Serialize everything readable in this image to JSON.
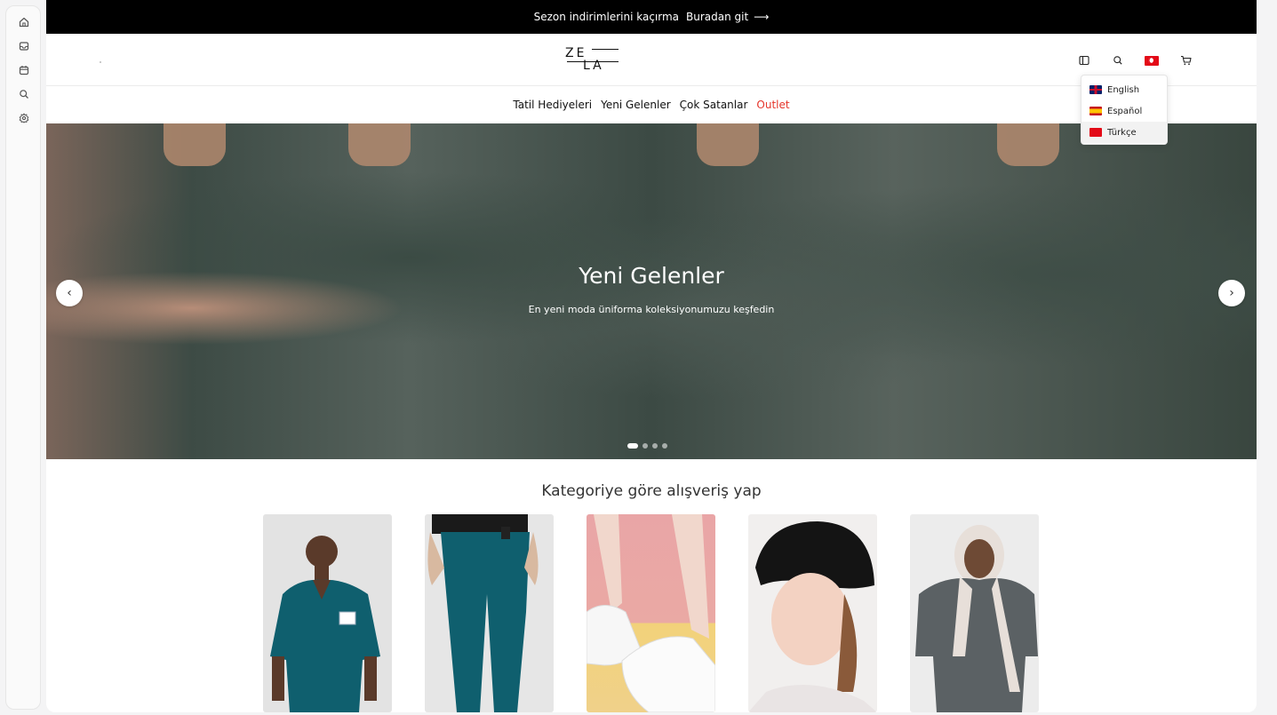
{
  "sidebar": {
    "items": [
      {
        "icon": "home-icon"
      },
      {
        "icon": "inbox-icon"
      },
      {
        "icon": "calendar-icon"
      },
      {
        "icon": "search-icon"
      },
      {
        "icon": "settings-icon"
      }
    ]
  },
  "announcement": {
    "text": "Sezon indirimlerini kaçırma",
    "link": "Buradan git",
    "arrow": "⟶"
  },
  "logo": {
    "top": "ZE",
    "bottom": "LA"
  },
  "header_icons": [
    "sidebar-toggle-icon",
    "search-icon",
    "turkish-flag-icon",
    "cart-icon"
  ],
  "language_menu": {
    "items": [
      {
        "label": "English",
        "flag": "uk-flag-icon"
      },
      {
        "label": "Español",
        "flag": "spain-flag-icon"
      },
      {
        "label": "Türkçe",
        "flag": "turkey-flag-icon",
        "selected": true
      }
    ]
  },
  "nav": {
    "items": [
      "Tatil Hediyeleri",
      "Yeni Gelenler",
      "Çok Satanlar",
      "Outlet"
    ],
    "outlet_color": "#e5352b"
  },
  "hero": {
    "title": "Yeni Gelenler",
    "subtitle": "En yeni moda üniforma koleksiyonumuzu keşfedin",
    "prev": "‹",
    "next": "›",
    "slide_count": 4,
    "active_slide": 1
  },
  "categories": {
    "title": "Kategoriye göre alışveriş yap"
  },
  "colors": {
    "announcement_bg": "#000000",
    "accent_red": "#e5352b",
    "scrub_teal": "#0f5f6e"
  }
}
